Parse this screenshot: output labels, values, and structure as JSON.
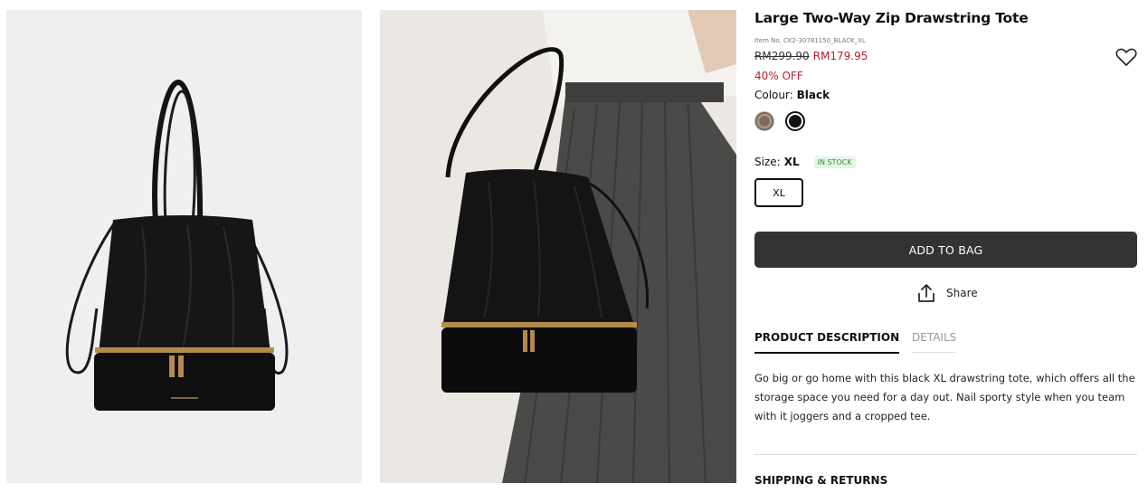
{
  "product": {
    "title": "Large Two-Way Zip Drawstring Tote",
    "item_no": "Item No. CK2-30781150_BLACK_XL",
    "price_original": "RM299.90",
    "price_sale": "RM179.95",
    "discount": "40% OFF",
    "colour_label": "Colour:",
    "colour_value": "Black",
    "size_label": "Size:",
    "size_value": "XL",
    "stock_badge": "IN STOCK",
    "size_options": [
      "XL"
    ]
  },
  "colors": {
    "sale_red": "#b7202e",
    "button_dark": "#333333",
    "stock_green": "#2f8a3c"
  },
  "actions": {
    "add_to_bag": "ADD TO BAG",
    "share": "Share",
    "wishlist_icon": "heart-icon",
    "share_icon": "share-upload-icon"
  },
  "tabs": [
    {
      "label": "PRODUCT DESCRIPTION",
      "active": true
    },
    {
      "label": "DETAILS",
      "active": false
    }
  ],
  "description": "Go big or go home with this black XL drawstring tote, which offers all the storage space you need for a day out. Nail sporty style when you team with it joggers and a cropped tee.",
  "shipping_title": "SHIPPING & RETURNS"
}
